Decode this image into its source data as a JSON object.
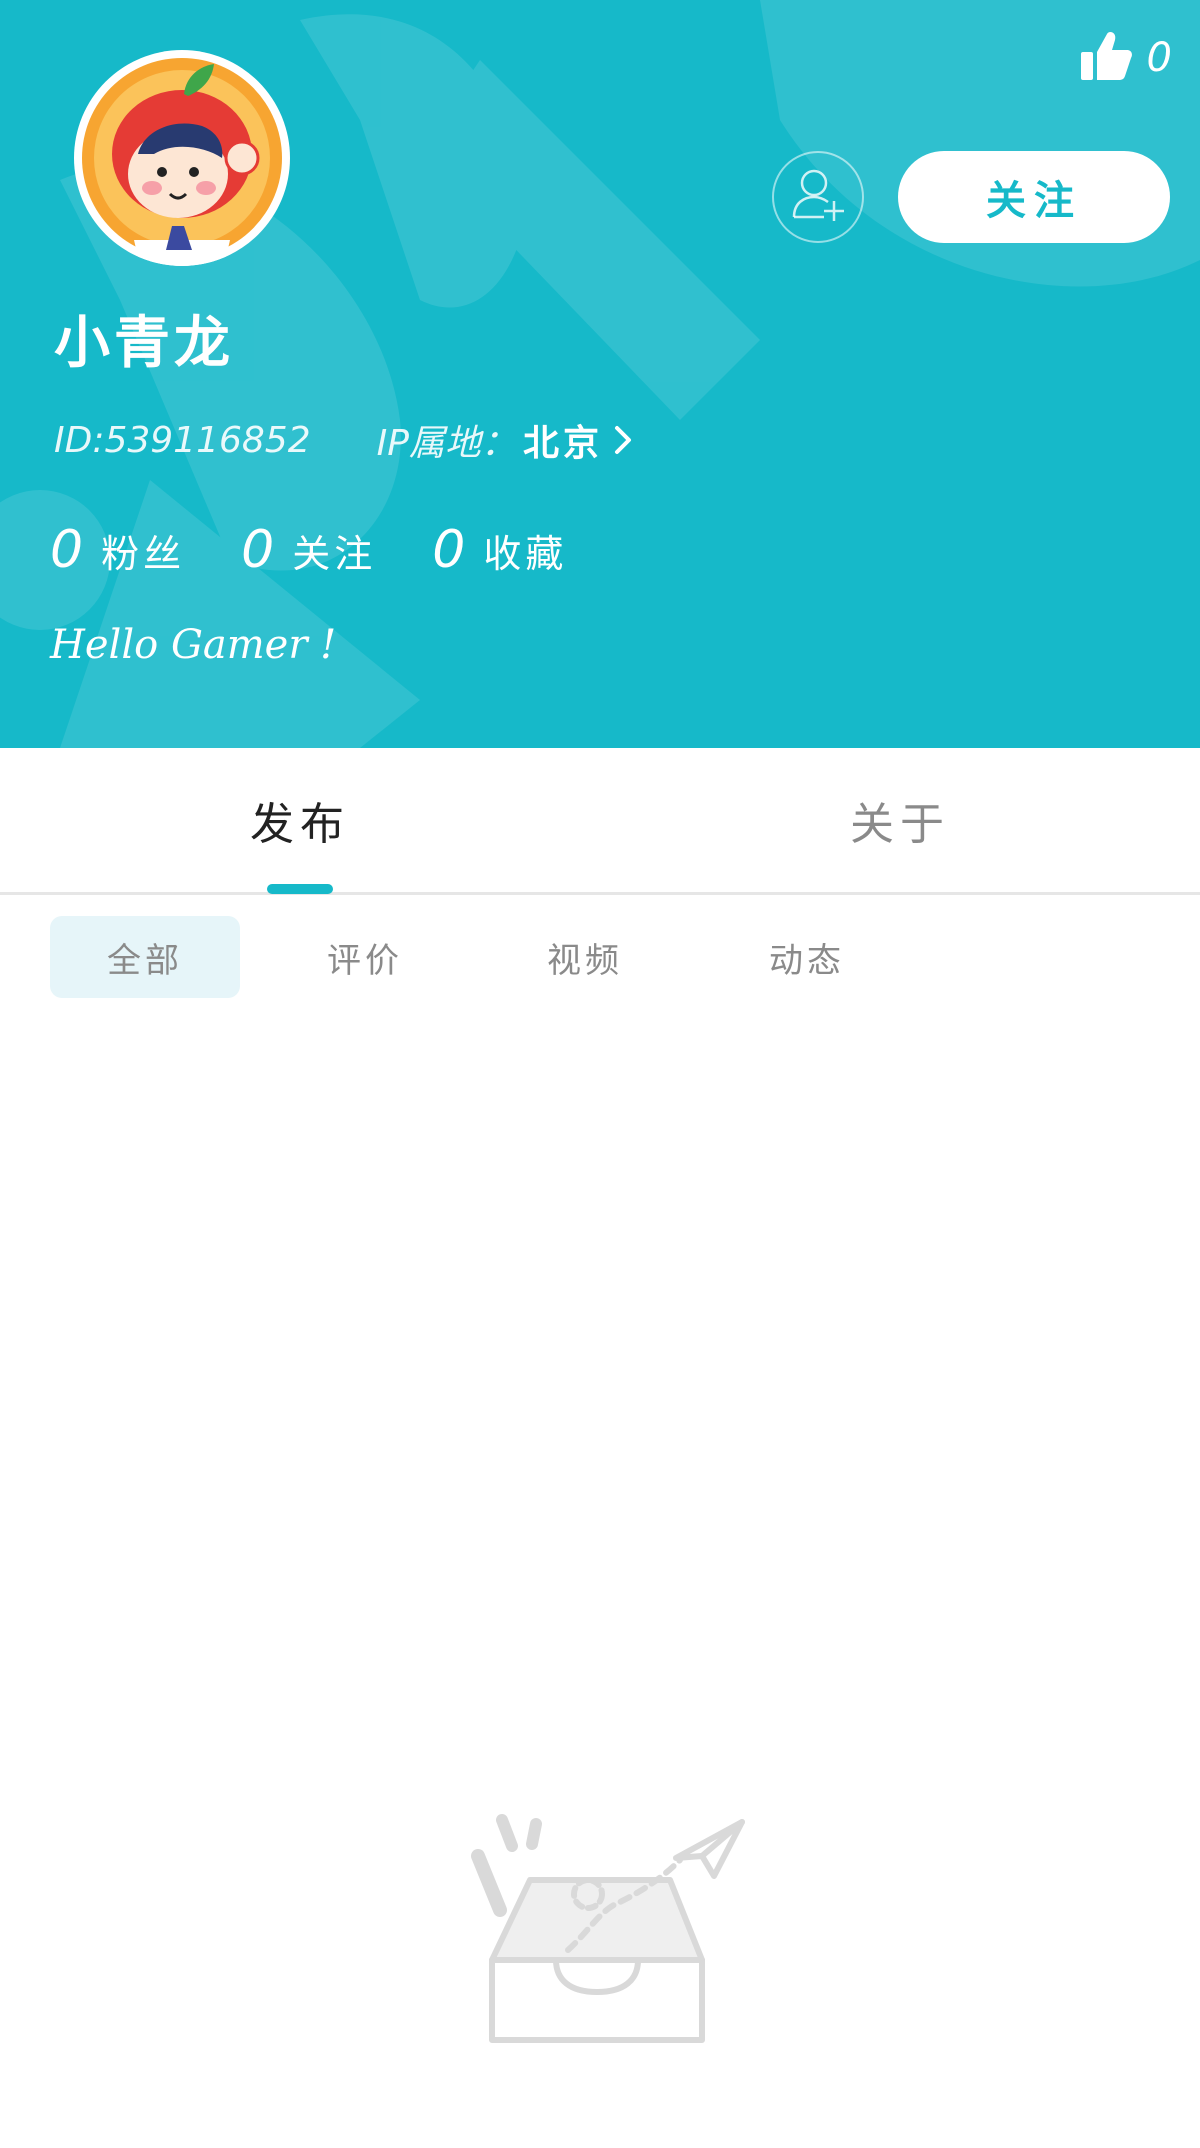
{
  "header": {
    "like_count": "0",
    "follow_label": "关注",
    "username": "小青龙",
    "id_text": "ID:539116852",
    "ip_label": "IP属地：",
    "ip_value": "北京",
    "bio": "Hello Gamer !",
    "background_color": "#16b9c9"
  },
  "stats": [
    {
      "value": "0",
      "label": "粉丝"
    },
    {
      "value": "0",
      "label": "关注"
    },
    {
      "value": "0",
      "label": "收藏"
    }
  ],
  "tabs": [
    {
      "label": "发布",
      "active": true
    },
    {
      "label": "关于",
      "active": false
    }
  ],
  "subtabs": [
    {
      "label": "全部",
      "selected": true
    },
    {
      "label": "评价",
      "selected": false
    },
    {
      "label": "视频",
      "selected": false
    },
    {
      "label": "动态",
      "selected": false
    }
  ],
  "icons": [
    "thumbs-up-icon",
    "add-friend-icon",
    "chevron-right-icon",
    "avatar",
    "empty-inbox-icon"
  ],
  "accent_color": "#16b9c9"
}
